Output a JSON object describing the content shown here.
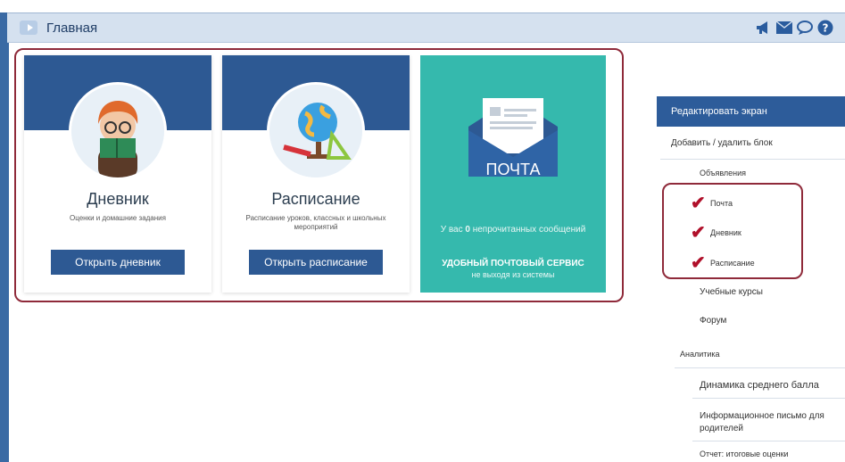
{
  "topbar": {
    "title": "Главная",
    "icons": [
      "megaphone-icon",
      "mail-icon",
      "chat-icon",
      "help-icon"
    ]
  },
  "cards": [
    {
      "title": "Дневник",
      "subtitle": "Оценки и домашние задания",
      "button": "Открыть дневник",
      "image": "student-reading-icon"
    },
    {
      "title": "Расписание",
      "subtitle": "Расписание уроков, классных и школьных мероприятий",
      "button": "Открыть расписание",
      "image": "globe-tools-icon"
    }
  ],
  "mail": {
    "label": "ПОЧТА",
    "unread_prefix": "У вас",
    "unread_count": "0",
    "unread_suffix": "непрочитанных сообщений",
    "promo_title": "УДОБНЫЙ ПОЧТОВЫЙ СЕРВИС",
    "promo_sub": "не выходя из системы",
    "icon": "envelope-icon"
  },
  "sidebar": {
    "edit": "Редактировать экран",
    "add_remove": "Добавить / удалить блок",
    "items": [
      {
        "label": "Объявления",
        "checked": false
      },
      {
        "label": "Почта",
        "checked": true
      },
      {
        "label": "Дневник",
        "checked": true
      },
      {
        "label": "Расписание",
        "checked": true
      },
      {
        "label": "Учебные курсы",
        "checked": false
      },
      {
        "label": "Форум",
        "checked": false
      }
    ],
    "analytics": "Аналитика",
    "analytics_items": [
      "Динамика среднего балла",
      "Информационное письмо для родителей",
      "Отчет: итоговые оценки"
    ]
  },
  "colors": {
    "accent": "#2d5993",
    "mail_bg": "#35b9ad",
    "highlight": "#8f2a3a",
    "check": "#b0102a"
  }
}
